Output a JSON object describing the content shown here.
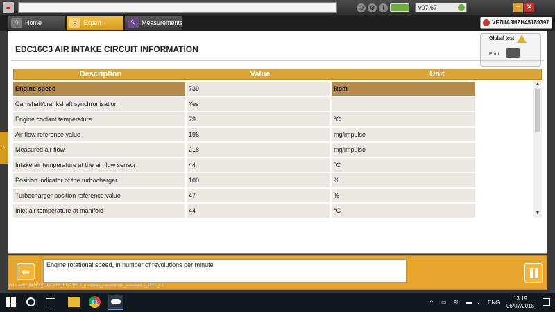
{
  "window": {
    "version": "v07.67",
    "minimize_label": "–",
    "close_label": "✕"
  },
  "tabs": [
    {
      "label": "Home",
      "icon": "home-icon"
    },
    {
      "label": "Expert",
      "icon": "search-icon"
    },
    {
      "label": "Measurements",
      "icon": "waveform-icon"
    }
  ],
  "vin": "VF7UA9HZH45189397",
  "page": {
    "title": "EDC16C3  AIR INTAKE CIRCUIT INFORMATION",
    "global_test_label": "Global test",
    "print_label": "Print"
  },
  "table": {
    "headers": {
      "description": "Description",
      "value": "Value",
      "unit": "Unit"
    },
    "rows": [
      {
        "description": "Engine speed",
        "value": "739",
        "unit": "Rpm",
        "selected": true
      },
      {
        "description": "Camshaft/crankshaft synchronisation",
        "value": "Yes",
        "unit": ""
      },
      {
        "description": "Engine coolant temperature",
        "value": "79",
        "unit": "°C"
      },
      {
        "description": "Air flow reference value",
        "value": "196",
        "unit": "mg/impulse"
      },
      {
        "description": "Measured air flow",
        "value": "218",
        "unit": "mg/impulse"
      },
      {
        "description": "Intake air temperature at the air flow sensor",
        "value": "44",
        "unit": "°C"
      },
      {
        "description": "Position indicator of the turbocharger",
        "value": "100",
        "unit": "%"
      },
      {
        "description": "Turbocharger position reference value",
        "value": "47",
        "unit": "%"
      },
      {
        "description": "Inlet air temperature at manifold",
        "value": "44",
        "unit": "°C"
      }
    ]
  },
  "help_text": "Engine rotational speed, in number of revolutions per minute",
  "status_path": "Vehicle\\b5\\INJ\\EDC16C3\\b5_EDC16C3_mesures_parametres_standard.s_1512_01",
  "taskbar": {
    "language": "ENG",
    "time": "13:19",
    "date": "06/07/2018"
  },
  "colors": {
    "accent": "#d9a536",
    "selected_row": "#b48a4c",
    "row_bg": "#ece8e1",
    "bottom_bar": "#e6a52a"
  }
}
